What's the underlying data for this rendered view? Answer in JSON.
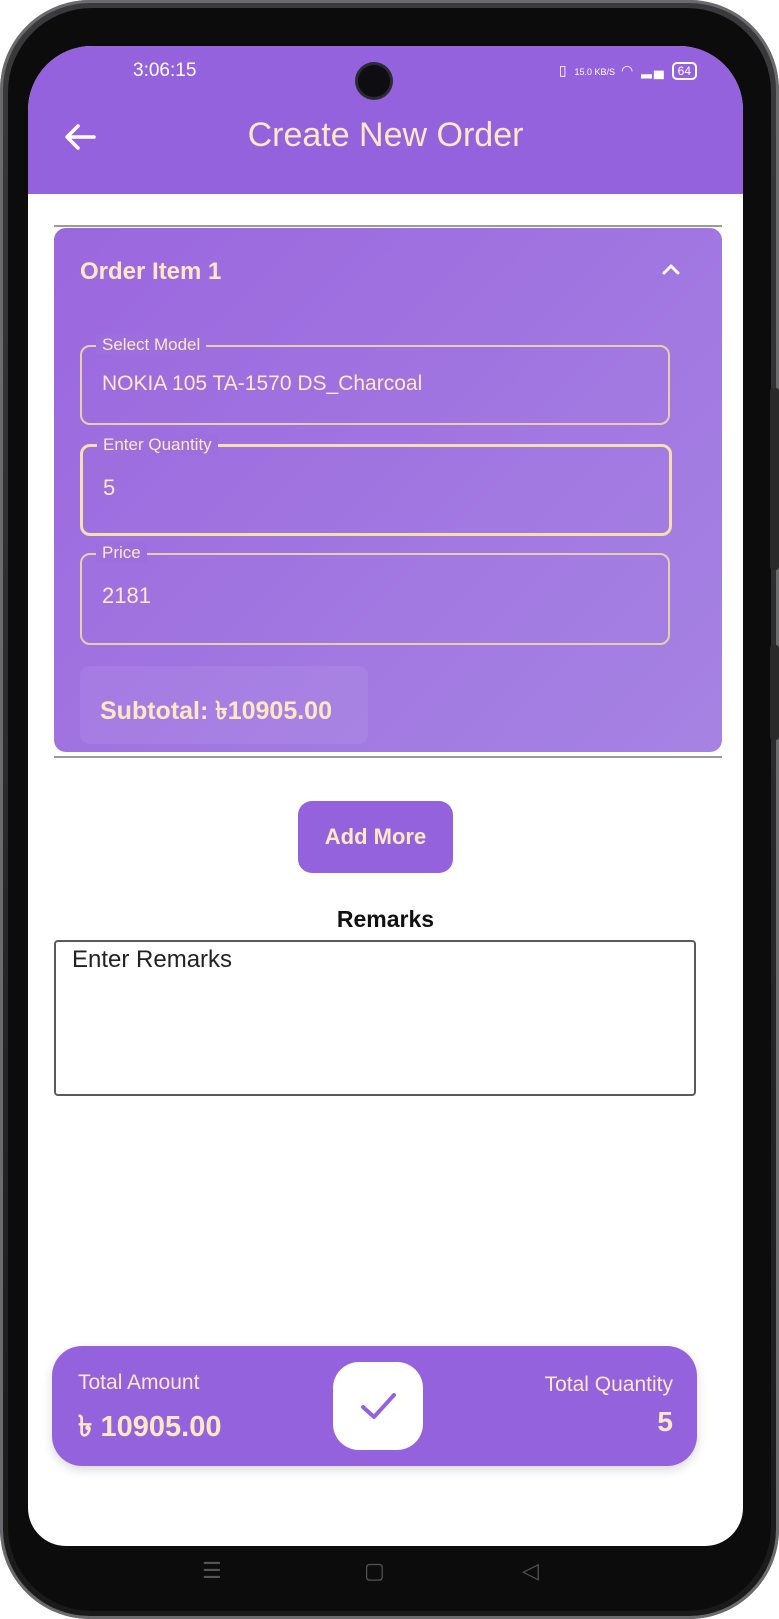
{
  "status": {
    "time": "3:06:15",
    "net_speed": "15.0 KB/S",
    "battery": "64"
  },
  "appbar": {
    "title": "Create New Order"
  },
  "order_item": {
    "title": "Order Item 1",
    "model_label": "Select Model",
    "model_value": "NOKIA 105 TA-1570 DS_Charcoal",
    "quantity_label": "Enter Quantity",
    "quantity_value": "5",
    "price_label": "Price",
    "price_value": "2181",
    "subtotal": "Subtotal: ৳10905.00"
  },
  "add_more_label": "Add More",
  "remarks": {
    "title": "Remarks",
    "placeholder": "Enter Remarks"
  },
  "footer": {
    "total_amount_label": "Total Amount",
    "total_amount_value": "৳ 10905.00",
    "total_quantity_label": "Total Quantity",
    "total_quantity_value": "5"
  },
  "colors": {
    "primary": "#9462dd",
    "accent_text": "#fde7c4"
  }
}
